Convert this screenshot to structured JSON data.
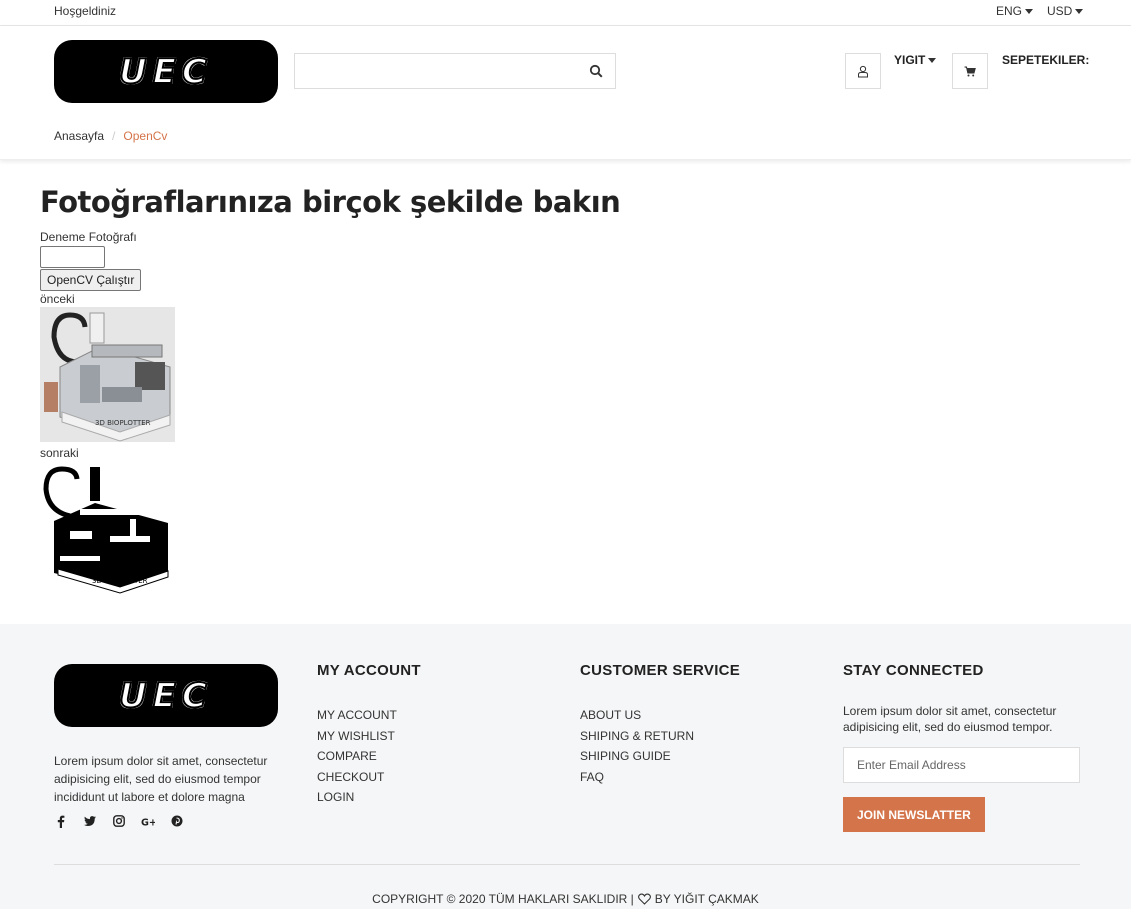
{
  "topbar": {
    "welcome": "Hoşgeldiniz",
    "language": "ENG",
    "currency": "USD"
  },
  "header": {
    "logo_text": "UEC",
    "search": {
      "placeholder": "",
      "value": ""
    },
    "user_name": "YIGIT",
    "cart_label": "SEPETEKILER:"
  },
  "breadcrumb": {
    "home": "Anasayfa",
    "separator": "/",
    "current": "OpenCv"
  },
  "main": {
    "title": "Fotoğraflarınıza birçok şekilde bakın",
    "file_label": "Deneme Fotoğrafı",
    "run_button": "OpenCV Çalıştır",
    "before_caption": "önceki",
    "after_caption": "sonraki"
  },
  "footer": {
    "logo_text": "UEC",
    "about": "Lorem ipsum dolor sit amet, consectetur adipisicing elit, sed do eiusmod tempor incididunt ut labore et dolore magna",
    "social_icons": [
      "facebook-icon",
      "twitter-icon",
      "instagram-icon",
      "google-plus-icon",
      "pinterest-icon"
    ],
    "my_account": {
      "title": "MY ACCOUNT",
      "links": [
        "MY ACCOUNT",
        "MY WISHLIST",
        "COMPARE",
        "CHECKOUT",
        "LOGIN"
      ]
    },
    "customer_service": {
      "title": "CUSTOMER SERVICE",
      "links": [
        "ABOUT US",
        "SHIPING & RETURN",
        "SHIPING GUIDE",
        "FAQ"
      ]
    },
    "stay_connected": {
      "title": "STAY CONNECTED",
      "text": "Lorem ipsum dolor sit amet, consectetur adipisicing elit, sed do eiusmod tempor.",
      "email_placeholder": "Enter Email Address",
      "button": "JOIN NEWSLATTER"
    },
    "copyright_left": "COPYRIGHT © 2020 TÜM HAKLARI SAKLIDIR |",
    "copyright_right": "BY YIĞIT ÇAKMAK"
  },
  "colors": {
    "accent": "#d4744a",
    "footer_bg": "#f5f6f7"
  }
}
